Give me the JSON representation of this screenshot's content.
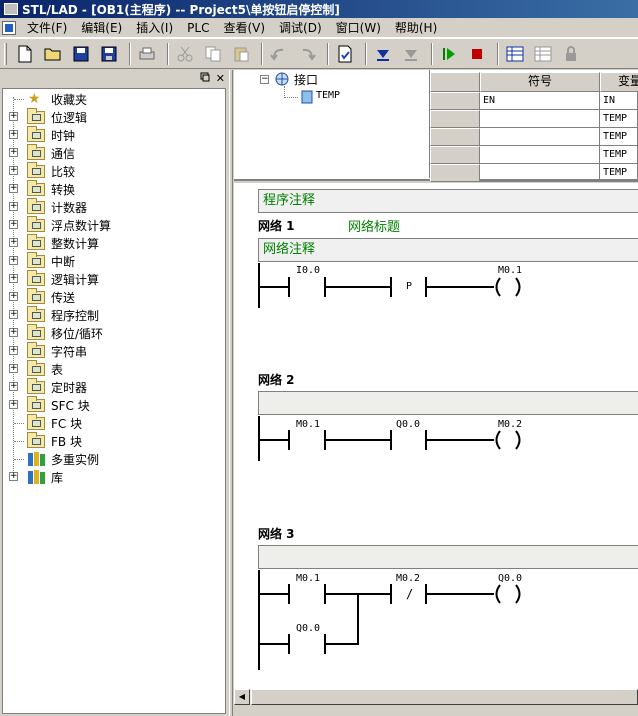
{
  "window": {
    "title": "STL/LAD - [OB1(主程序) -- Project5\\单按钮启停控制]"
  },
  "menu": [
    "文件(F)",
    "编辑(E)",
    "插入(I)",
    "PLC",
    "查看(V)",
    "调试(D)",
    "窗口(W)",
    "帮助(H)"
  ],
  "toolbar": {
    "icons": [
      "new-icon",
      "open-icon",
      "save-icon",
      "save-all-icon",
      "print-icon",
      "cut-icon",
      "copy-icon",
      "paste-icon",
      "undo-icon",
      "redo-icon",
      "compile-icon",
      "download-icon",
      "upload-icon",
      "run-icon",
      "stop-icon",
      "status-chart-icon",
      "program-status-icon",
      "lock-icon"
    ]
  },
  "left_panel": {
    "pin_glyph": "ё",
    "close_glyph": "✕",
    "tree": [
      {
        "label": "收藏夹",
        "icon": "star-icon",
        "expand": false
      },
      {
        "label": "位逻辑",
        "icon": "folder-icon",
        "expand": true
      },
      {
        "label": "时钟",
        "icon": "folder-icon",
        "expand": true
      },
      {
        "label": "通信",
        "icon": "folder-icon",
        "expand": true
      },
      {
        "label": "比较",
        "icon": "folder-icon",
        "expand": true
      },
      {
        "label": "转换",
        "icon": "folder-icon",
        "expand": true
      },
      {
        "label": "计数器",
        "icon": "folder-icon",
        "expand": true
      },
      {
        "label": "浮点数计算",
        "icon": "folder-icon",
        "expand": true
      },
      {
        "label": "整数计算",
        "icon": "folder-icon",
        "expand": true
      },
      {
        "label": "中断",
        "icon": "folder-icon",
        "expand": true
      },
      {
        "label": "逻辑计算",
        "icon": "folder-icon",
        "expand": true
      },
      {
        "label": "传送",
        "icon": "folder-icon",
        "expand": true
      },
      {
        "label": "程序控制",
        "icon": "folder-icon",
        "expand": true
      },
      {
        "label": "移位/循环",
        "icon": "folder-icon",
        "expand": true
      },
      {
        "label": "字符串",
        "icon": "folder-icon",
        "expand": true
      },
      {
        "label": "表",
        "icon": "folder-icon",
        "expand": true
      },
      {
        "label": "定时器",
        "icon": "folder-icon",
        "expand": true
      },
      {
        "label": "SFC 块",
        "icon": "folder-icon",
        "expand": true
      },
      {
        "label": "FC 块",
        "icon": "folder-icon",
        "expand": false
      },
      {
        "label": "FB 块",
        "icon": "folder-icon",
        "expand": false
      },
      {
        "label": "多重实例",
        "icon": "books-icon",
        "expand": false
      },
      {
        "label": "库",
        "icon": "books-icon",
        "expand": true
      }
    ]
  },
  "interface": {
    "root": "接口",
    "child": "TEMP",
    "headers": [
      "符号",
      "变量"
    ],
    "rows": [
      {
        "symbol": "EN",
        "var": "IN"
      },
      {
        "symbol": "",
        "var": "TEMP"
      },
      {
        "symbol": "",
        "var": "TEMP"
      },
      {
        "symbol": "",
        "var": "TEMP"
      },
      {
        "symbol": "",
        "var": "TEMP"
      }
    ]
  },
  "editor": {
    "program_comment": "程序注释",
    "networks": [
      {
        "label": "网络 1",
        "title": "网络标题",
        "comment": "网络注释",
        "contacts": [
          "I0.0",
          "P"
        ],
        "coil": "M0.1"
      },
      {
        "label": "网络 2",
        "title": "",
        "comment": "",
        "contacts": [
          "M0.1",
          "Q0.0"
        ],
        "coil": "M0.2"
      },
      {
        "label": "网络 3",
        "title": "",
        "comment": "",
        "contacts": [
          "M0.1",
          "M0.2",
          "Q0.0"
        ],
        "slash": "/",
        "coil": "Q0.0"
      }
    ]
  }
}
